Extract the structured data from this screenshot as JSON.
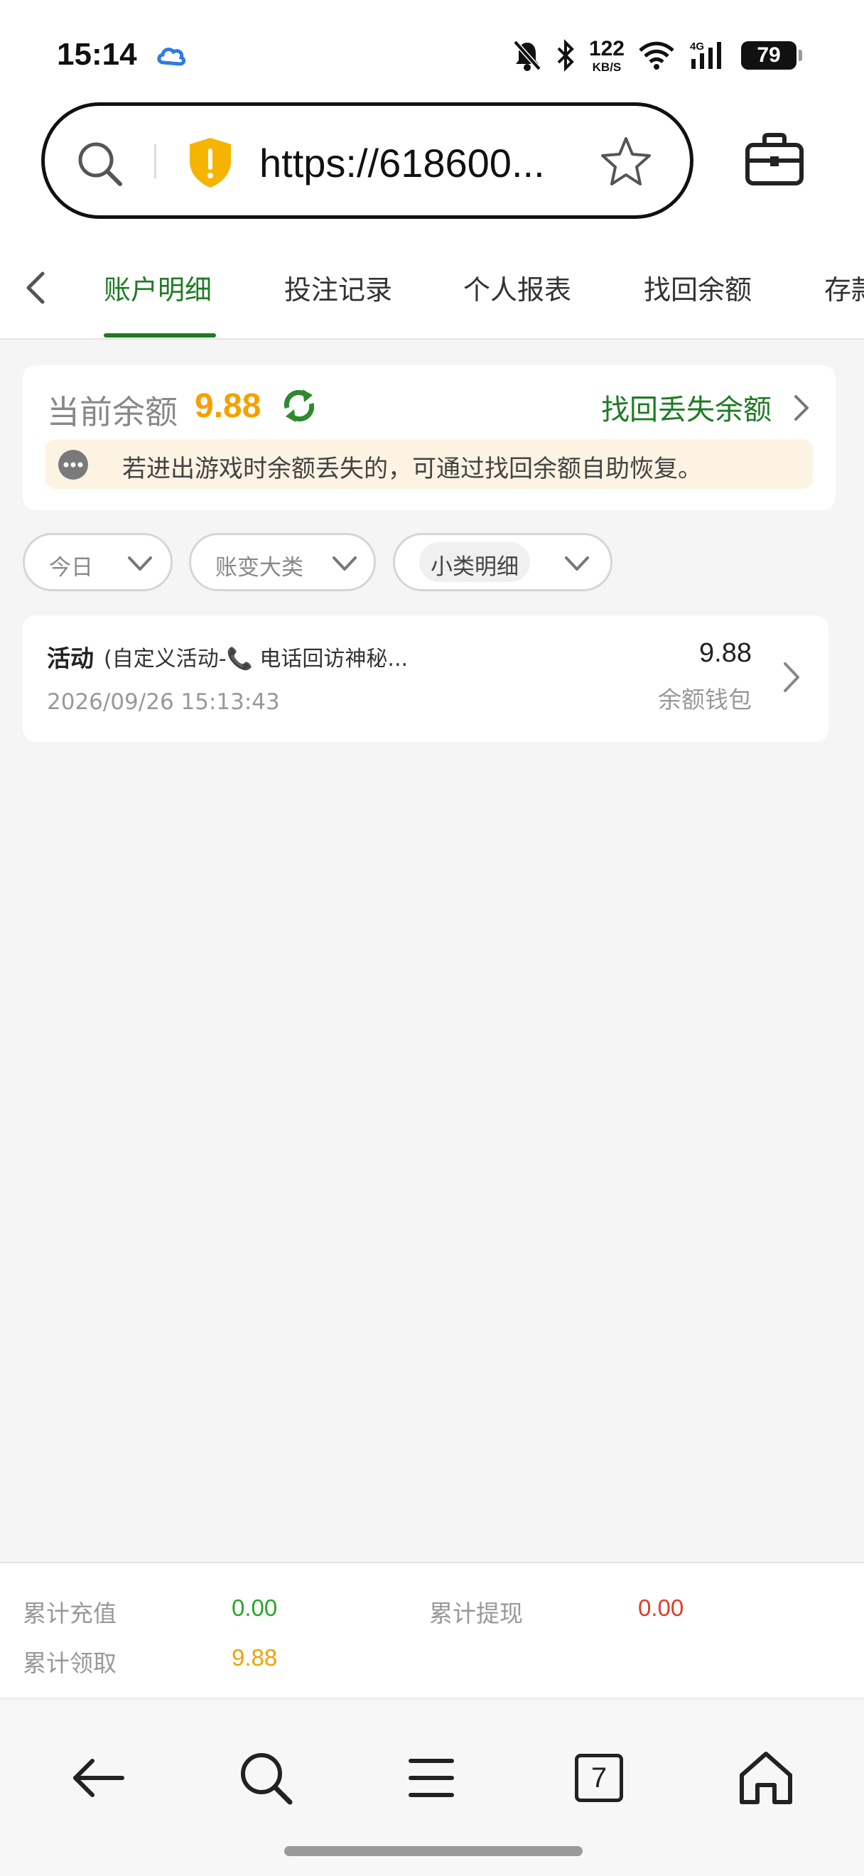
{
  "status_bar": {
    "time": "15:14",
    "net_speed_value": "122",
    "net_speed_unit": "KB/S",
    "battery": "79",
    "icons": [
      "cloud-icon",
      "mute-bell-icon",
      "bluetooth-icon",
      "wifi-icon",
      "signal-4g-icon",
      "battery-icon"
    ]
  },
  "browser": {
    "url": "https://618600...",
    "search_icon": "search-icon",
    "security_icon": "warning-shield-icon",
    "bookmark_icon": "star-icon",
    "toolbox_icon": "toolbox-icon"
  },
  "tabs": {
    "back_icon": "chevron-left-icon",
    "items": [
      {
        "label": "账户明细",
        "active": true
      },
      {
        "label": "投注记录",
        "active": false
      },
      {
        "label": "个人报表",
        "active": false
      },
      {
        "label": "找回余额",
        "active": false
      },
      {
        "label": "存款",
        "active": false
      }
    ]
  },
  "balance": {
    "label": "当前余额",
    "value": "9.88",
    "find_link": "找回丢失余额",
    "notice": "若进出游戏时余额丢失的，可通过找回余额自助恢复。"
  },
  "filters": [
    {
      "label": "今日"
    },
    {
      "label": "账变大类"
    },
    {
      "label": "小类明细"
    }
  ],
  "records": [
    {
      "type": "活动",
      "description": "(自定义活动-📞 电话回访神秘...",
      "time": "2026/09/26 15:13:43",
      "amount": "9.88",
      "wallet": "余额钱包"
    }
  ],
  "summary": {
    "recharge_label": "累计充值",
    "recharge_value": "0.00",
    "withdraw_label": "累计提现",
    "withdraw_value": "0.00",
    "claim_label": "累计领取",
    "claim_value": "9.88"
  },
  "bottom_nav": {
    "tab_count": "7",
    "icons": [
      "back-arrow-icon",
      "search-icon",
      "menu-icon",
      "tabs-icon",
      "home-icon"
    ]
  },
  "colors": {
    "accent_green": "#1e7b24",
    "balance_orange": "#f5a000",
    "recharge_green": "#2aa52a",
    "withdraw_red": "#e03c2c"
  }
}
